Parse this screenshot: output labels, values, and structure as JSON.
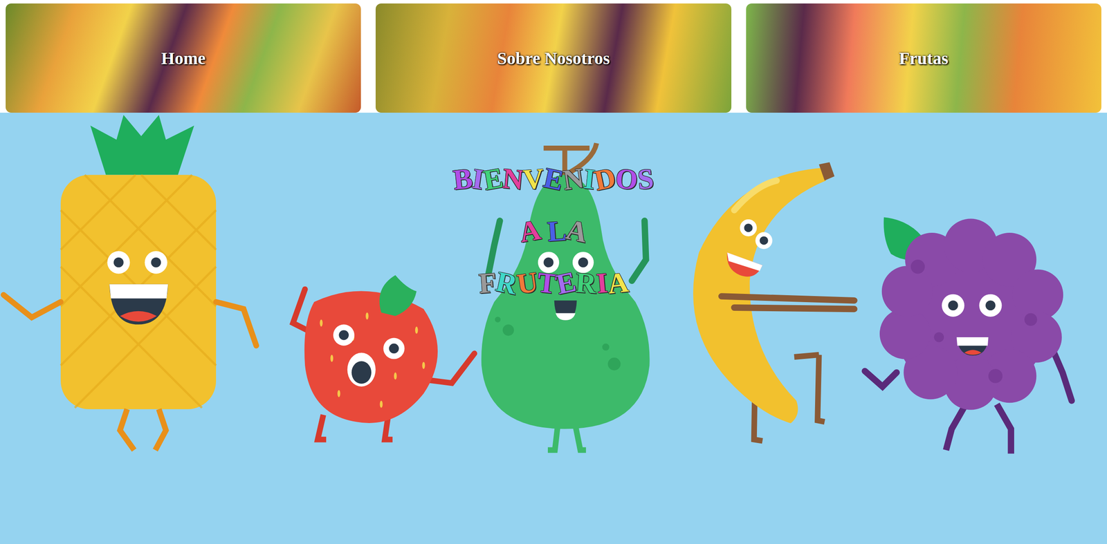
{
  "nav": [
    {
      "label": "Home"
    },
    {
      "label": "Sobre Nosotros"
    },
    {
      "label": "Frutas"
    }
  ],
  "hero": {
    "lines": [
      "BIENVENIDOS",
      "A LA",
      "FRUTERIA"
    ]
  }
}
